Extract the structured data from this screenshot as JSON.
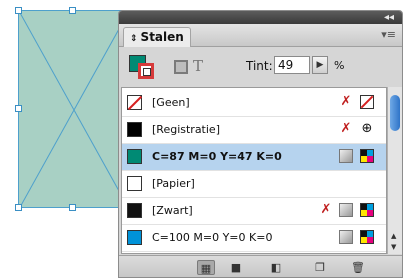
{
  "panel": {
    "tab_label": "Stalen",
    "tab_arrows": "⇕",
    "menu_icon": "panel-menu-icon",
    "collapse_icon": "collapse-icon"
  },
  "toolbar": {
    "tint_label": "Tint:",
    "tint_value": "49",
    "tint_unit": "%",
    "text_icon_glyph": "T"
  },
  "swatches": [
    {
      "name": "[Geen]",
      "chip": "none",
      "color": "#ffffff",
      "bold": false,
      "selected": false,
      "icons": [
        "no-edit-icon",
        "none-swatch-icon"
      ]
    },
    {
      "name": "[Registratie]",
      "chip": "solid",
      "color": "#000000",
      "bold": false,
      "selected": false,
      "icons": [
        "no-edit-icon",
        "registration-mark-icon"
      ]
    },
    {
      "name": "C=87 M=0 Y=47 K=0",
      "chip": "solid",
      "color": "#008a74",
      "bold": true,
      "selected": true,
      "icons": [
        "process-color-icon",
        "cmyk-mode-icon"
      ]
    },
    {
      "name": "[Papier]",
      "chip": "solid",
      "color": "#ffffff",
      "bold": false,
      "selected": false,
      "icons": []
    },
    {
      "name": "[Zwart]",
      "chip": "solid",
      "color": "#111111",
      "bold": false,
      "selected": false,
      "icons": [
        "no-edit-icon",
        "process-color-icon",
        "cmyk-mode-icon"
      ]
    },
    {
      "name": "C=100 M=0 Y=0 K=0",
      "chip": "solid",
      "color": "#0092d8",
      "bold": false,
      "selected": false,
      "icons": [
        "process-color-icon",
        "cmyk-mode-icon"
      ]
    }
  ],
  "bottom_buttons": [
    "show-all-swatches-button",
    "show-color-swatches-button",
    "show-gradient-swatches-button",
    "new-swatch-button",
    "delete-swatch-button"
  ],
  "colors": {
    "frame_fill": "#a8d0c4",
    "selection_blue": "#b6d3ee",
    "accent_teal": "#008a74"
  }
}
